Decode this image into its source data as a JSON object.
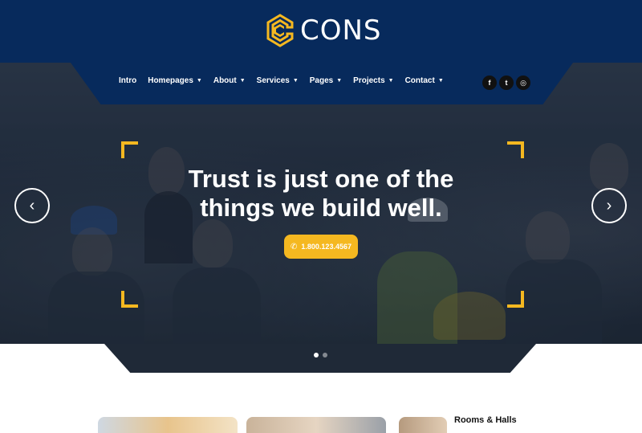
{
  "brand": {
    "name": "CONS",
    "accent": "#f5b820",
    "navy": "#072a5c"
  },
  "nav": {
    "items": [
      {
        "label": "Intro",
        "dropdown": false
      },
      {
        "label": "Homepages",
        "dropdown": true
      },
      {
        "label": "About",
        "dropdown": true
      },
      {
        "label": "Services",
        "dropdown": true
      },
      {
        "label": "Pages",
        "dropdown": true
      },
      {
        "label": "Projects",
        "dropdown": true
      },
      {
        "label": "Contact",
        "dropdown": true
      }
    ],
    "social": [
      {
        "icon": "facebook-icon",
        "glyph": "f"
      },
      {
        "icon": "twitter-icon",
        "glyph": "t"
      },
      {
        "icon": "instagram-icon",
        "glyph": "◎"
      }
    ]
  },
  "hero": {
    "headline_line1": "Trust is just one of the",
    "headline_line2": "things we build well.",
    "cta_label": "1.800.123.4567",
    "cta_icon": "phone-icon",
    "slides": {
      "count": 2,
      "active": 1
    }
  },
  "services": {
    "card_title": "Rooms & Halls"
  }
}
